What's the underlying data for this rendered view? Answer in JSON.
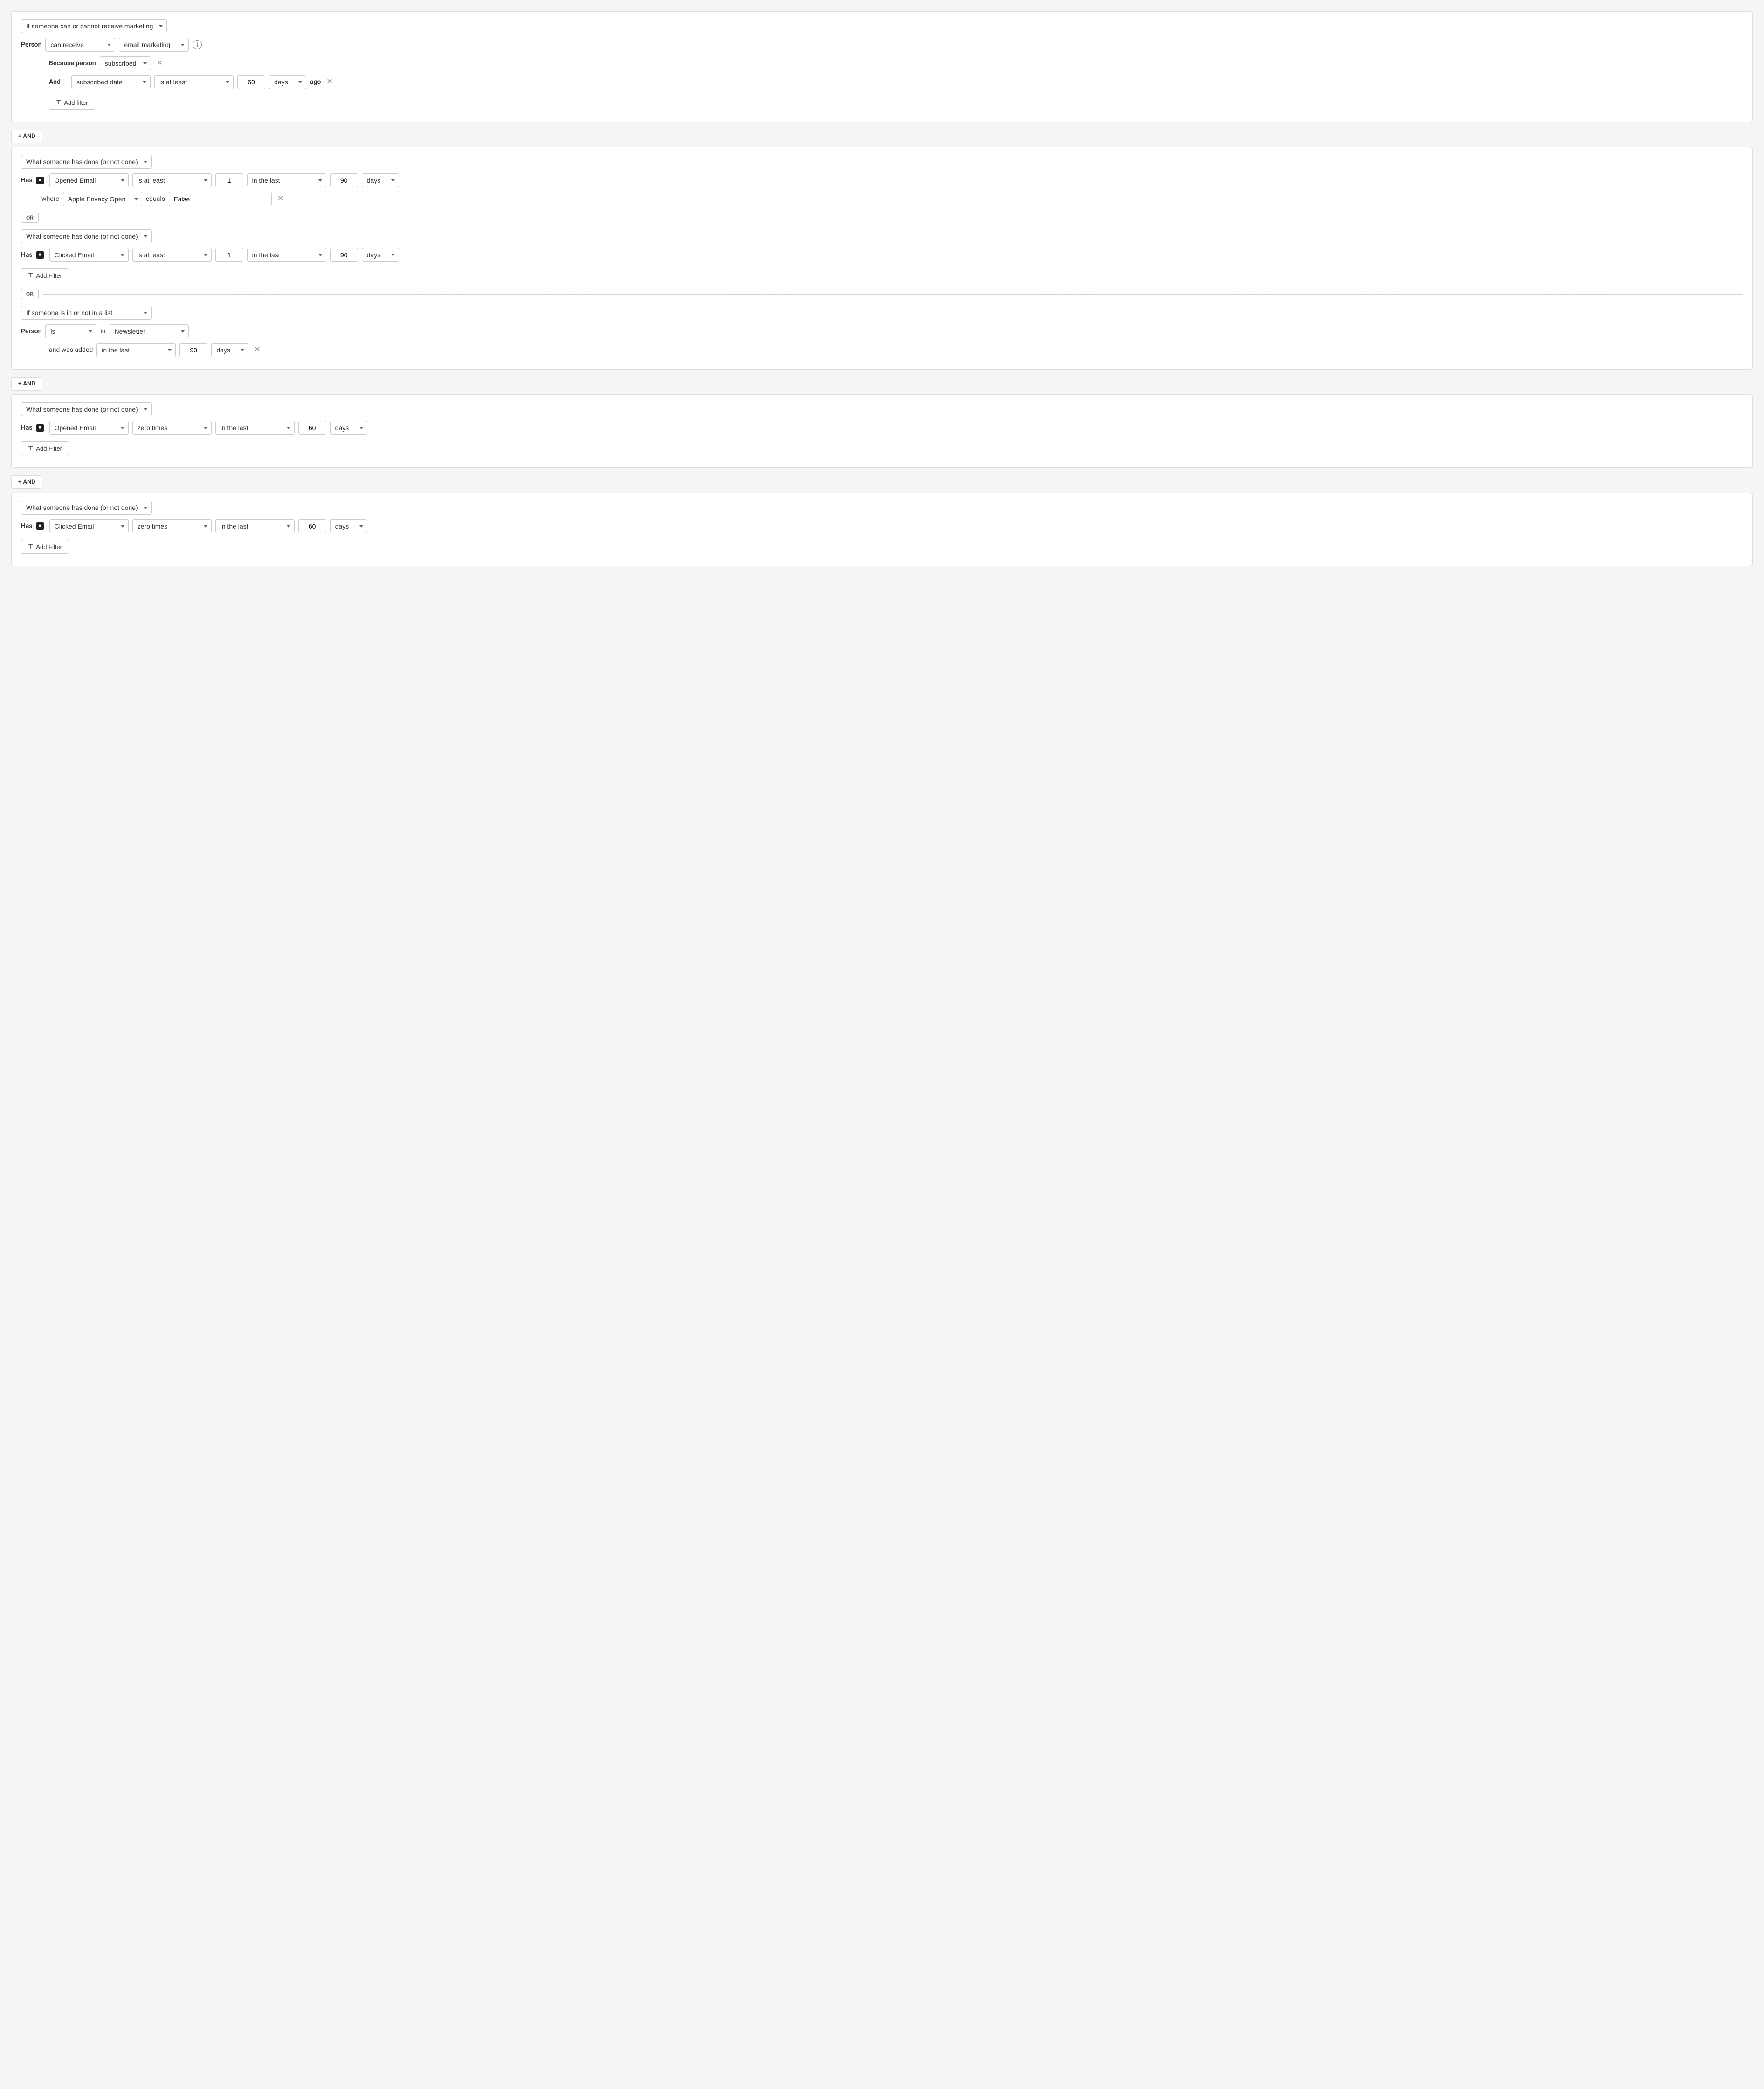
{
  "blocks": [
    {
      "id": "block1",
      "type": "marketing",
      "mainSelect": "If someone can or cannot receive marketing",
      "personLabel": "Person",
      "canReceiveSelect": "can receive",
      "marketingTypeSelect": "email marketing",
      "becauseLabel": "Because person",
      "subscribedSelect": "subscribed",
      "andLabel": "And",
      "andFilters": [
        {
          "dateSelect": "subscribed date",
          "conditionSelect": "is at least",
          "value": "60",
          "unitSelect": "days",
          "agoLabel": "ago"
        }
      ],
      "addFilterLabel": "Add filter"
    },
    {
      "id": "block2",
      "type": "actions",
      "subBlocks": [
        {
          "id": "sub1",
          "mainSelect": "What someone has done (or not done)",
          "hasLabel": "Has",
          "actionSelect": "Opened Email",
          "conditionSelect": "is at least",
          "value": "1",
          "timeRangeSelect": "in the last",
          "timeValue": "90",
          "timeUnitSelect": "days",
          "whereFilters": [
            {
              "fieldSelect": "Apple Privacy Open",
              "equalsLabel": "equals",
              "equalsValue": "False"
            }
          ]
        },
        {
          "id": "sub2",
          "mainSelect": "What someone has done (or not done)",
          "hasLabel": "Has",
          "actionSelect": "Clicked Email",
          "conditionSelect": "is at least",
          "value": "1",
          "timeRangeSelect": "in the last",
          "timeValue": "90",
          "timeUnitSelect": "days",
          "addFilterLabel": "Add Filter"
        },
        {
          "id": "sub3",
          "mainSelect": "If someone is in or not in a list",
          "personLabel": "Person",
          "isSelect": "is",
          "inLabel": "in",
          "listSelect": "Newsletter",
          "andWasAddedLabel": "and was added",
          "timeRangeSelect": "in the last",
          "timeValue": "90",
          "timeUnitSelect": "days"
        }
      ]
    },
    {
      "id": "block3",
      "type": "actions",
      "subBlocks": [
        {
          "id": "sub4",
          "mainSelect": "What someone has done (or not done)",
          "hasLabel": "Has",
          "actionSelect": "Opened Email",
          "conditionSelect": "zero times",
          "timeRangeSelect": "in the last",
          "timeValue": "60",
          "timeUnitSelect": "days",
          "addFilterLabel": "Add Filter"
        }
      ]
    },
    {
      "id": "block4",
      "type": "actions",
      "subBlocks": [
        {
          "id": "sub5",
          "mainSelect": "What someone has done (or not done)",
          "hasLabel": "Has",
          "actionSelect": "Clicked Email",
          "conditionSelect": "zero times",
          "timeRangeSelect": "in the last",
          "timeValue": "60",
          "timeUnitSelect": "days",
          "addFilterLabel": "Add Filter"
        }
      ]
    }
  ],
  "andConnectorLabel": "+ AND",
  "orLabel": "OR"
}
